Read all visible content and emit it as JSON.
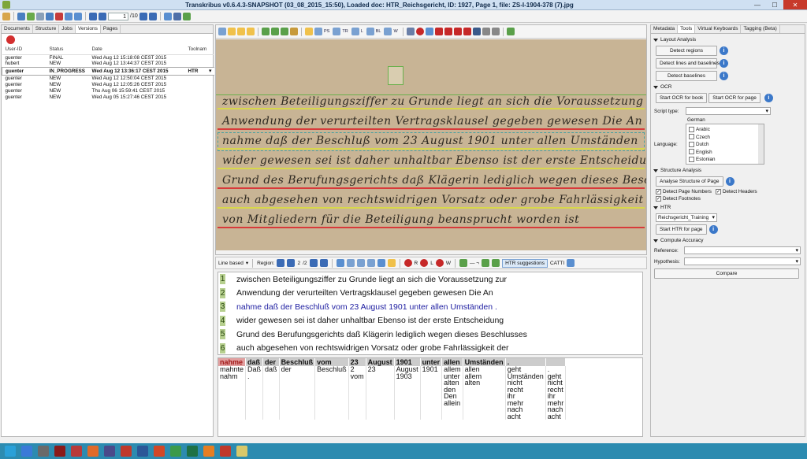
{
  "title": "Transkribus v0.6.4.3-SNAPSHOT (03_08_2015_15:50), Loaded doc: HTR_Reichsgericht, ID: 1927, Page 1, file: ZS-I-1904-378 (7).jpg",
  "window_controls": {
    "minimize": "—",
    "maximize": "☐",
    "close": "✕"
  },
  "main_toolbar": {
    "page_current": "1",
    "page_total": "/10"
  },
  "left_tabs": [
    "Documents",
    "Structure",
    "Jobs",
    "Versions",
    "Pages"
  ],
  "versions": {
    "columns": [
      "User-ID",
      "Status",
      "Date",
      "Toolnam"
    ],
    "rows": [
      {
        "user": "guenter",
        "status": "FINAL",
        "date": "Wed Aug 12 15:18:08 CEST 2015",
        "tool": ""
      },
      {
        "user": "hubert",
        "status": "NEW",
        "date": "Wed Aug 12 13:44:37 CEST 2015",
        "tool": ""
      },
      {
        "user": "guenter",
        "status": "IN_PROGRESS",
        "date": "Wed Aug 12 13:36:17 CEST 2015",
        "tool": "HTR"
      },
      {
        "user": "guenter",
        "status": "NEW",
        "date": "Wed Aug 12 12:50:04 CEST 2015",
        "tool": ""
      },
      {
        "user": "guenter",
        "status": "NEW",
        "date": "Wed Aug 12 12:05:26 CEST 2015",
        "tool": ""
      },
      {
        "user": "guenter",
        "status": "NEW",
        "date": "Thu Aug 06 15:59:41 CEST 2015",
        "tool": ""
      },
      {
        "user": "guenter",
        "status": "NEW",
        "date": "Wed Aug 05 15:27:46 CEST 2015",
        "tool": ""
      }
    ]
  },
  "image_toolbar": {
    "labels": [
      "PS",
      "TR",
      "L",
      "BL",
      "W"
    ],
    "colors": {
      "accent": "#2d5fa6",
      "red": "#c62828"
    }
  },
  "handwriting_lines": [
    "zwischen Beteiligungsziffer zu Grunde liegt an sich die Voraussetzung zur",
    "Anwendung der verurteilten Vertragsklausel gegeben gewesen Die An",
    "nahme daß der Beschluß vom 23 August 1901 unter allen Umständen",
    "wider gewesen sei ist daher unhaltbar Ebenso ist der erste Entscheidung",
    "Grund des Berufungsgerichts daß Klägerin lediglich wegen dieses Beschlusses",
    "auch abgesehen von rechtswidrigen Vorsatz oder grobe Fahrlässigkeit der",
    "von Mitgliedern für die Beteiligung beansprucht worden ist"
  ],
  "text_toolbar": {
    "mode": "Line based",
    "region_label": "Region:",
    "region_current": "2",
    "region_total": "/2",
    "buttons": [
      "R",
      "L",
      "W"
    ],
    "htr_suggestions": "HTR suggestions",
    "catti": "CATTI"
  },
  "transcript_lines": [
    {
      "num": "1",
      "text": "zwischen Beteiligungsziffer zu Grunde liegt an sich die Voraussetzung zur"
    },
    {
      "num": "2",
      "text": "Anwendung der verurteilten Vertragsklausel gegeben gewesen Die An"
    },
    {
      "num": "3",
      "text": "nahme daß der Beschluß vom 23 August 1901 unter allen Umständen ."
    },
    {
      "num": "4",
      "text": "wider gewesen sei ist daher unhaltbar Ebenso ist der erste Entscheidung"
    },
    {
      "num": "5",
      "text": "Grund des Berufungsgerichts daß Klägerin lediglich wegen dieses Beschlusses"
    },
    {
      "num": "6",
      "text": "auch abgesehen von rechtswidrigen Vorsatz oder grobe Fahrlässigkeit der"
    }
  ],
  "htr_candidates": {
    "headers": [
      "nahme",
      "daß",
      "der",
      "Beschluß",
      "vom",
      "23",
      "August",
      "1901",
      "unter",
      "allen",
      "Umständen",
      ".",
      ""
    ],
    "columns": [
      [
        "mahnte",
        "nahm"
      ],
      [
        "Daß",
        "."
      ],
      [
        "daß"
      ],
      [
        "der"
      ],
      [
        "Beschluß"
      ],
      [
        "2",
        "vom"
      ],
      [
        "23"
      ],
      [
        "August",
        "1903"
      ],
      [
        "1901"
      ],
      [
        "allem",
        "unter",
        "alten",
        "den",
        "Den",
        "allein"
      ],
      [
        "allen",
        "allem",
        "alten"
      ],
      [
        "geht",
        "Umständen",
        "nicht",
        "recht",
        "ihr",
        "mehr",
        "nach",
        "acht"
      ],
      [
        ".",
        "geht",
        "nicht",
        "recht",
        "ihr",
        "mehr",
        "nach",
        "acht"
      ]
    ]
  },
  "right_tabs": [
    "Metadata",
    "Tools",
    "Virtual Keyboards",
    "Tagging (Beta)"
  ],
  "tools": {
    "layout_section": "Layout Analysis",
    "detect_regions": "Detect regions",
    "detect_lines": "Detect lines and baselines",
    "detect_baselines": "Detect baselines",
    "ocr_section": "OCR",
    "start_ocr_book": "Start OCR for book",
    "start_ocr_page": "Start OCR for page",
    "script_type_label": "Script type:",
    "language_label": "Language:",
    "language_selected": "German",
    "languages": [
      "Arabic",
      "Czech",
      "Dutch",
      "English",
      "Estonian"
    ],
    "structure_section": "Structure Analysis",
    "analyse_structure": "Analyse Structure of Page",
    "detect_page_numbers": "Detect Page Numbers",
    "detect_headers": "Detect Headers",
    "detect_footnotes": "Detect Footnotes",
    "htr_section": "HTR",
    "htr_model": "Reichsgericht_Training",
    "start_htr": "Start HTR for page",
    "accuracy_section": "Compute Accuracy",
    "reference_label": "Reference:",
    "hypothesis_label": "Hypothesis:",
    "compare": "Compare",
    "info": "i"
  },
  "taskbar_apps": [
    "start",
    "ie",
    "app2",
    "app3",
    "app4",
    "firefox",
    "app6",
    "pdf",
    "word",
    "ppt",
    "chrome",
    "excel",
    "app12",
    "app13",
    "transkribus"
  ]
}
